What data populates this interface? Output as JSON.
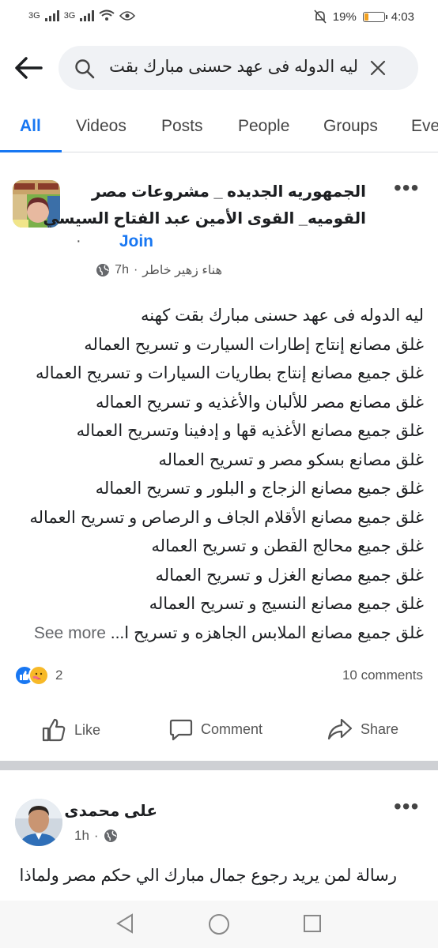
{
  "status_bar": {
    "signal_1": "3G",
    "signal_2": "3G",
    "battery": "19%",
    "time": "4:03"
  },
  "search": {
    "query": "ليه الدوله فى عهد حسنى مبارك بقت"
  },
  "tabs": [
    {
      "label": "All",
      "active": true
    },
    {
      "label": "Videos"
    },
    {
      "label": "Posts"
    },
    {
      "label": "People"
    },
    {
      "label": "Groups"
    },
    {
      "label": "Eve"
    }
  ],
  "post1": {
    "group_line1": "الجمهوريه الجديده _ مشروعات مصر",
    "group_line2": "القوميه_ القوى الأمين عبد الفتاح السيسي",
    "join_label": "Join",
    "dot": "·",
    "author": "هناء زهير خاطر",
    "time": "7h",
    "lines": [
      "ليه الدوله فى عهد حسنى مبارك بقت كهنه",
      "غلق مصانع إنتاج إطارات السيارت و تسريح العماله",
      "غلق جميع مصانع إنتاج بطاريات السيارات و تسريح العماله",
      "غلق مصانع مصر للألبان والأغذيه و تسريح العماله",
      "غلق جميع مصانع الأغذيه قها و إدفينا وتسريح العماله",
      "غلق مصانع بسكو مصر و تسريح العماله",
      "غلق جميع مصانع الزجاج و البلور و تسريح العماله",
      "غلق جميع مصانع الأقلام الجاف و الرصاص و تسريح العماله",
      "غلق جميع محالج القطن و تسريح العماله",
      "غلق جميع مصانع الغزل و تسريح العماله",
      "غلق جميع مصانع النسيج و تسريح العماله"
    ],
    "last_line": "غلق جميع مصانع الملابس الجاهزه و تسريح ا...",
    "see_more": "See more",
    "reaction_count": "2",
    "comments": "10 comments",
    "like": "Like",
    "comment": "Comment",
    "share": "Share"
  },
  "post2": {
    "author": "على محمدى",
    "time": "1h",
    "text": "رسالة لمن يريد رجوع جمال مبارك الي حكم مصر  ولماذا"
  },
  "colors": {
    "accent": "#1877f2",
    "text": "#1c1e21",
    "secondary": "#65676b",
    "search_bg": "#f0f2f5",
    "battery": "#f0a020"
  }
}
